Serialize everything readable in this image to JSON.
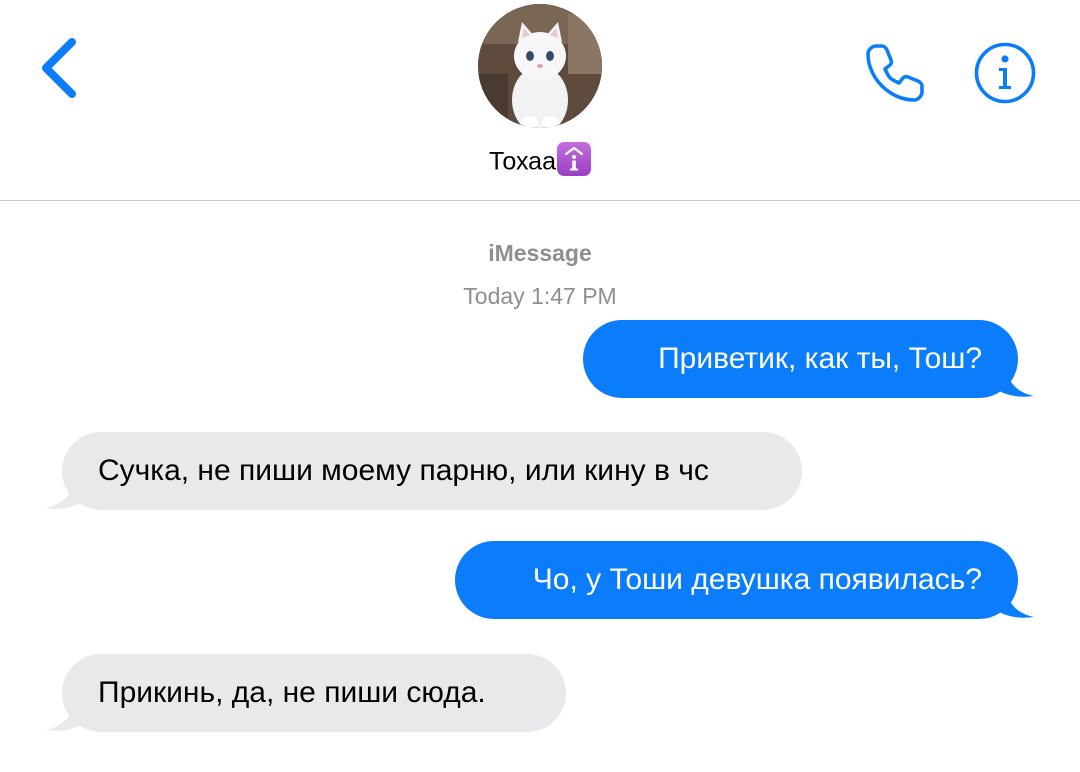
{
  "header": {
    "contact_name": "Тохаа",
    "badge_icon": "info-emoji-badge",
    "back_icon": "chevron-left-icon",
    "call_icon": "phone-icon",
    "info_icon": "info-icon",
    "accent_color": "#0b7dfb"
  },
  "conversation": {
    "service": "iMessage",
    "timestamp": "Today 1:47 PM",
    "messages": [
      {
        "direction": "outgoing",
        "text": "Приветик, как ты, Тош?"
      },
      {
        "direction": "incoming",
        "text": "Сучка, не пиши моему парню, или кину в чс"
      },
      {
        "direction": "outgoing",
        "text": "Чо, у Тоши девушка появилась?"
      },
      {
        "direction": "incoming",
        "text": "Прикинь, да, не пиши сюда."
      }
    ]
  },
  "colors": {
    "outgoing_bubble": "#0b7dfb",
    "incoming_bubble": "#e9e9eb",
    "meta_text": "#8e8e93"
  }
}
